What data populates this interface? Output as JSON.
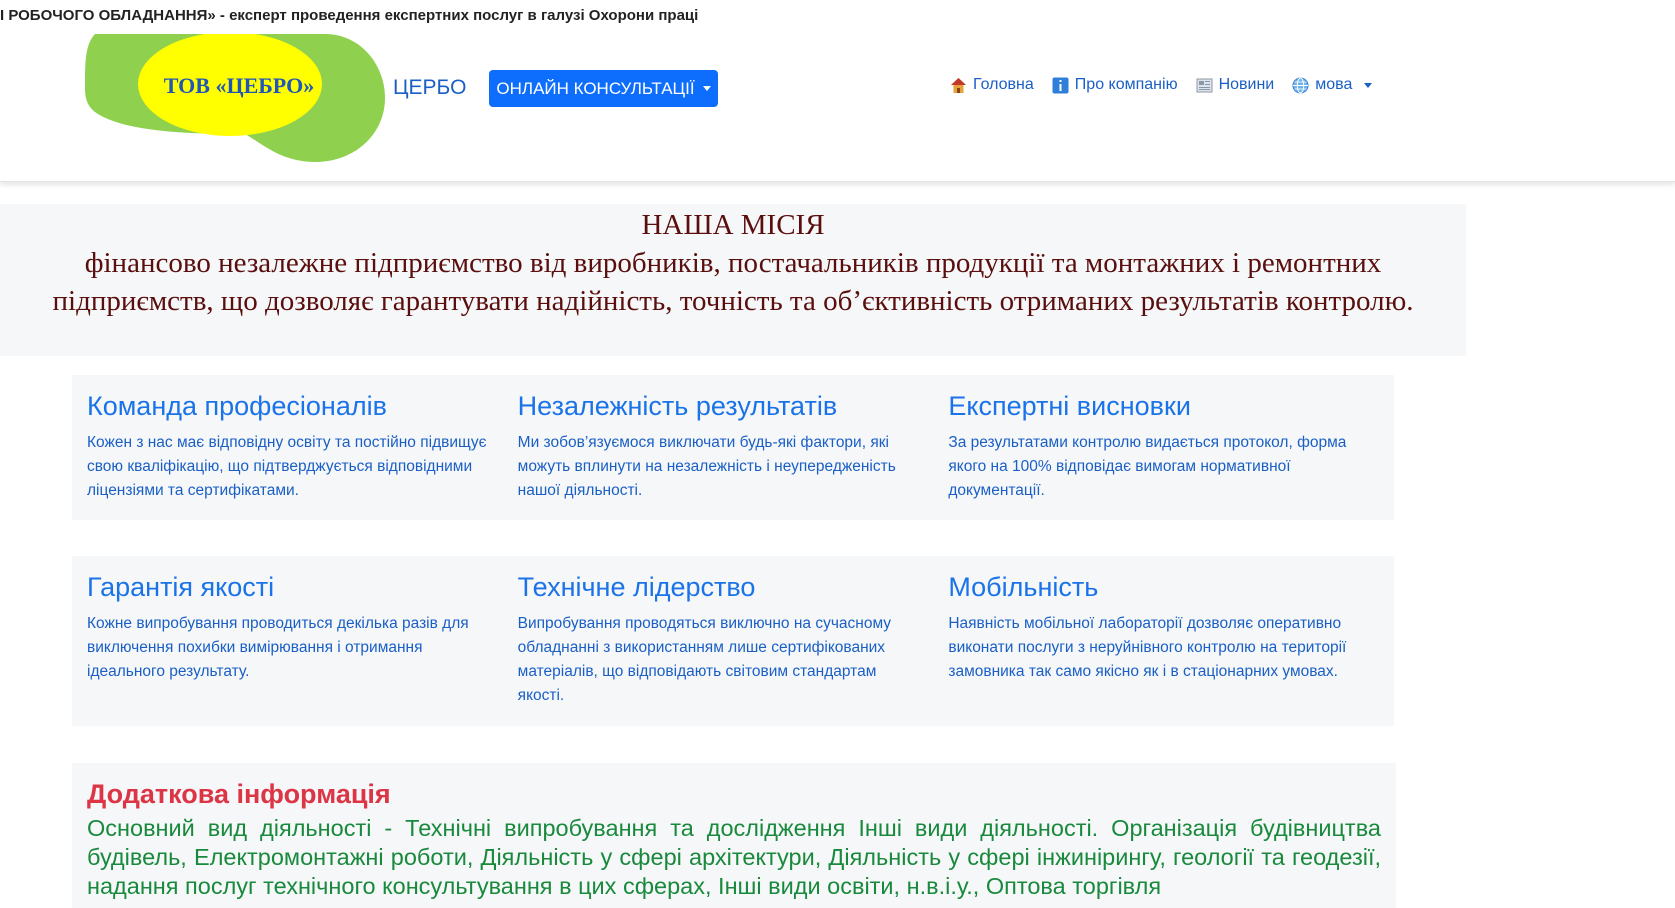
{
  "marquee_text": "І РОБОЧОГО ОБЛАДНАННЯ» - експерт проведення експертних послуг в галузі Охорони праці",
  "header": {
    "logo_text": "ТОВ «ЦЕБРО»",
    "brand": "ЦЕРБО",
    "consult_button": "ОНЛАЙН КОНСУЛЬТАЦІЇ",
    "nav": [
      {
        "label": "Головна",
        "icon": "house-icon"
      },
      {
        "label": "Про компанію",
        "icon": "info-icon"
      },
      {
        "label": "Новини",
        "icon": "newspaper-icon"
      },
      {
        "label": "мова",
        "icon": "globe-icon"
      }
    ]
  },
  "colors": {
    "primary": "#0d6efd",
    "logo_green": "#8fd14f",
    "logo_yellow": "#ffff00",
    "mission_text": "#5a0e0e",
    "info_heading": "#dc3545",
    "info_text": "#198a3d"
  },
  "mission": {
    "title": "НАША МІСІЯ",
    "text": "фінансово незалежне підприємство від виробників, постачальників продукції та монтажних і ремонтних підприємств, що дозволяє гарантувати надійність, точність та об’єктивність отриманих результатів контролю."
  },
  "features_row1": [
    {
      "title": "Команда професіоналів",
      "text": "Кожен з нас має відповідну освіту та постійно підвищує свою кваліфікацію, що підтверджується відповідними ліцензіями та сертифікатами."
    },
    {
      "title": "Незалежність результатів",
      "text": "Ми зобов’язуємося виключати будь-які фактори, які можуть вплинути на незалежність і неупередженість нашої діяльності."
    },
    {
      "title": "Експертні висновки",
      "text": "За результатами контролю видається протокол, форма якого на 100% відповідає вимогам нормативної документації."
    }
  ],
  "features_row2": [
    {
      "title": "Гарантія якості",
      "text": "Кожне випробування проводиться декілька разів для виключення похибки вимірювання і отримання ідеального результату."
    },
    {
      "title": "Технічне лідерство",
      "text": "Випробування проводяться виключно на сучасному обладнанні з використанням лише сертифікованих матеріалів, що відповідають світовим стандартам якості."
    },
    {
      "title": "Мобільність",
      "text": "Наявність мобільної лабораторії дозволяє оперативно виконати послуги з неруйнівного контролю на території замовника так само якісно як і в стаціонарних умовах."
    }
  ],
  "info": {
    "title": "Додаткова інформація",
    "text": "Основний вид діяльності - Технічні випробування та дослідження Інші види діяльності. Організація будівництва будівель, Електромонтажні роботи, Діяльність у сфері архітектури, Діяльність у сфері інжинірингу, геології та геодезії, надання послуг технічного консультування в цих сферах, Інші види освіти, н.в.і.у., Оптова торгівля"
  }
}
